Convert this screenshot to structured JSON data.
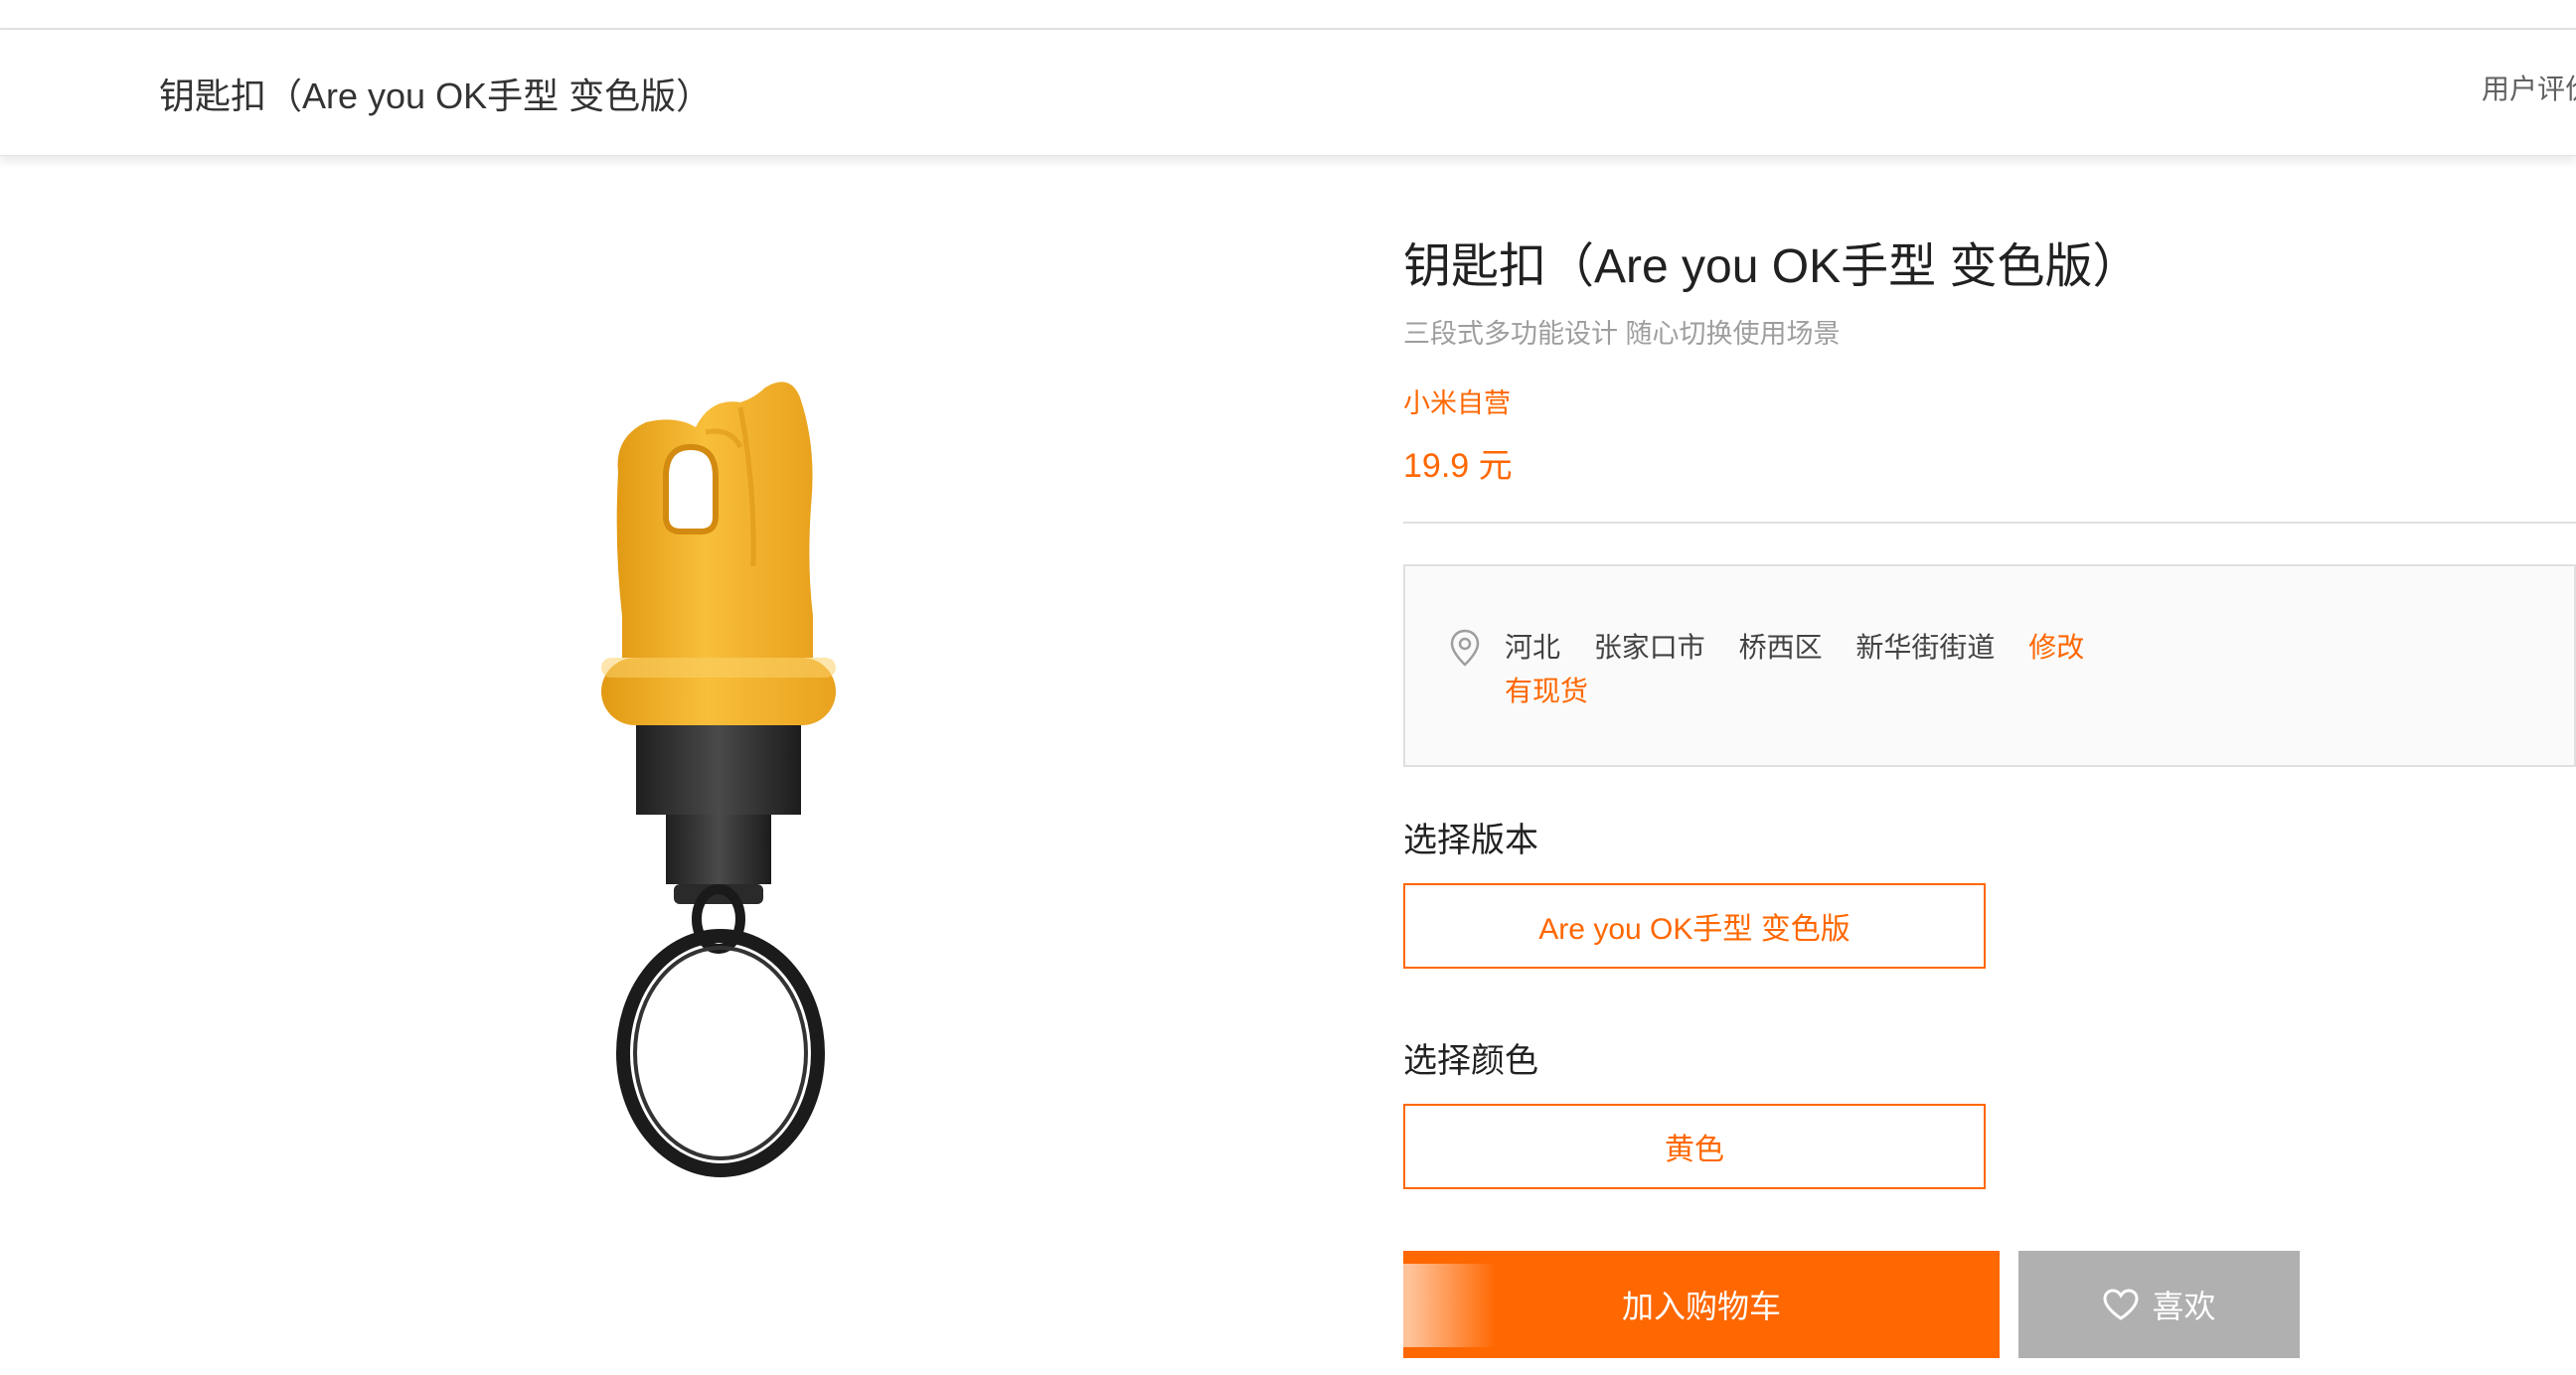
{
  "sticky_header": {
    "title": "钥匙扣（Are you OK手型 变色版）",
    "reviews_link": "用户评价"
  },
  "product": {
    "title": "钥匙扣（Are you OK手型 变色版）",
    "subtitle": "三段式多功能设计 随心切换使用场景",
    "seller": "小米自营",
    "price": "19.9 元",
    "image_icon": "ok-hand-keychain-image"
  },
  "address": {
    "icon": "location-pin-icon",
    "province": "河北",
    "city": "张家口市",
    "district": "桥西区",
    "street": "新华街街道",
    "edit_label": "修改",
    "stock_status": "有现货"
  },
  "version": {
    "label": "选择版本",
    "selected": "Are you OK手型 变色版"
  },
  "color": {
    "label": "选择颜色",
    "selected": "黄色"
  },
  "actions": {
    "add_to_cart": "加入购物车",
    "like": "喜欢",
    "like_icon": "heart-icon"
  },
  "colors": {
    "accent": "#ff6700",
    "like_button": "#b0b0b0",
    "product_yellow": "#f5b52e"
  }
}
